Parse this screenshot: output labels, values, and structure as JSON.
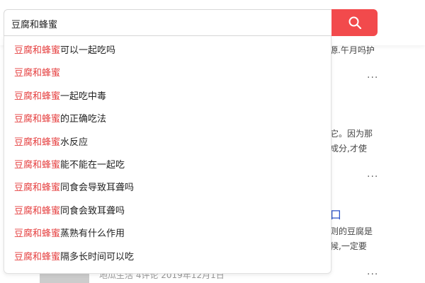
{
  "search": {
    "query": "豆腐和蜂蜜",
    "highlight_color": "#e53e3e",
    "button_color": "#f24a4c",
    "button_icon": "search-icon"
  },
  "suggestions": [
    {
      "match": "豆腐和蜂蜜",
      "rest": "可以一起吃吗"
    },
    {
      "match": "豆腐和蜂蜜",
      "rest": ""
    },
    {
      "match": "豆腐和蜂蜜",
      "rest": "一起吃中毒"
    },
    {
      "match": "豆腐和蜂蜜",
      "rest": "的正确吃法"
    },
    {
      "match": "豆腐和蜂蜜",
      "rest": "水反应"
    },
    {
      "match": "豆腐和蜂蜜",
      "rest": "能不能在一起吃"
    },
    {
      "match": "豆腐和蜂蜜",
      "rest": "同食会导致耳聋吗"
    },
    {
      "match": "豆腐和蜂蜜",
      "rest": "同食会致耳聋吗"
    },
    {
      "match": "豆腐和蜂蜜",
      "rest": "蒸熟有什么作用"
    },
    {
      "match": "豆腐和蜂蜜",
      "rest": "隔多长时间可以吃"
    }
  ],
  "background": {
    "snippet_1": "源.午月吗护",
    "snippet_2a": "它。因为那",
    "snippet_2b": "成分,才使",
    "snippet_3_title": "口",
    "snippet_3a": "则的豆腐是",
    "snippet_3b": "候,一定要",
    "meta": "地瓜生活  4评论  2019年12月1日",
    "more": "···"
  }
}
